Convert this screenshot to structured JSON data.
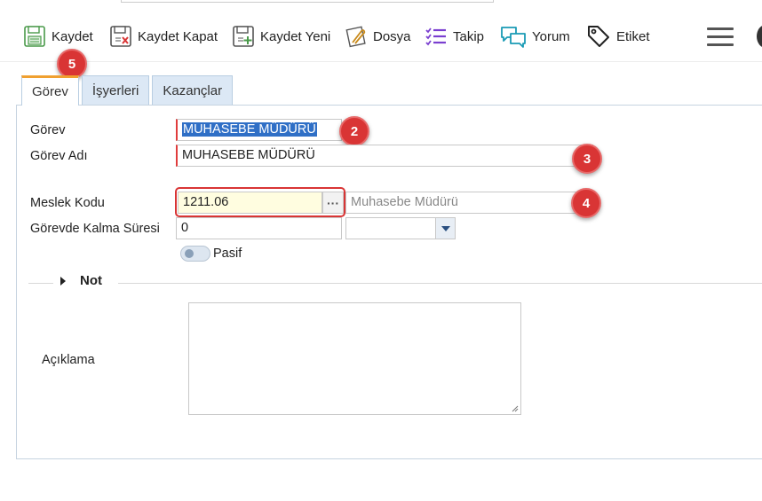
{
  "toolbar": {
    "save": "Kaydet",
    "save_close": "Kaydet Kapat",
    "save_new": "Kaydet Yeni",
    "file": "Dosya",
    "follow": "Takip",
    "comment": "Yorum",
    "tag": "Etiket"
  },
  "badges": {
    "b2": "2",
    "b3": "3",
    "b4": "4",
    "b5": "5"
  },
  "tabs": [
    "Görev",
    "İşyerleri",
    "Kazançlar"
  ],
  "form": {
    "gorev_label": "Görev",
    "gorev_value": "MUHASEBE MÜDÜRÜ",
    "gorev_adi_label": "Görev Adı",
    "gorev_adi_value": "MUHASEBE MÜDÜRÜ",
    "meslek_kodu_label": "Meslek Kodu",
    "meslek_kodu_value": "1211.06",
    "meslek_adi_placeholder": "Muhasebe Müdürü",
    "kalma_suresi_label": "Görevde Kalma Süresi",
    "kalma_suresi_value": "0",
    "pasif_label": "Pasif",
    "dots": "···"
  },
  "note_section": {
    "title": "Not",
    "aciklama_label": "Açıklama"
  },
  "colors": {
    "accent_red": "#d93535",
    "tab_active_top": "#f0a030",
    "selection": "#2f6fc6"
  }
}
